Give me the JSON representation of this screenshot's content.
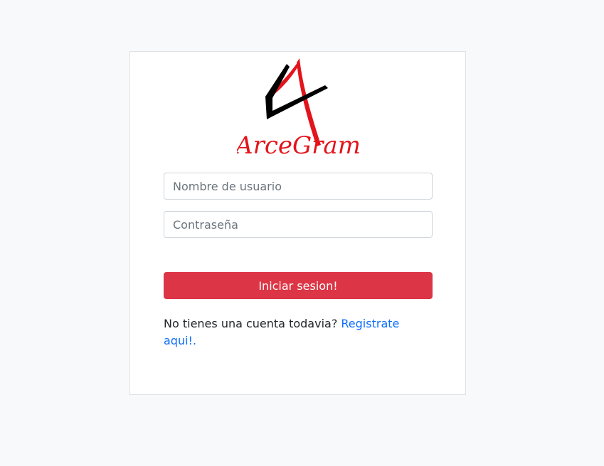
{
  "brand": {
    "logo_text": "ArceGram",
    "logo_colors": {
      "red": "#e3141b",
      "black": "#000000"
    }
  },
  "form": {
    "username_placeholder": "Nombre de usuario",
    "password_placeholder": "Contraseña",
    "submit_label": "Iniciar sesion!"
  },
  "register": {
    "prompt": "No tienes una cuenta todavia?",
    "link_label": "Registrate aqui!."
  },
  "colors": {
    "background": "#f8f9fa",
    "button": "#dc3545",
    "link": "#0d6efd"
  }
}
